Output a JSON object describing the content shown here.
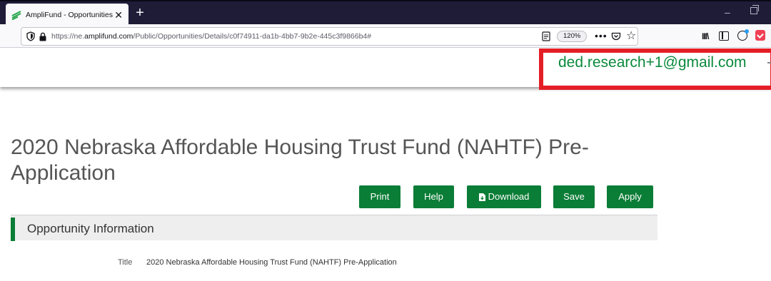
{
  "browser": {
    "tab_title": "AmpliFund - Opportunities",
    "tab_close": "✕",
    "new_tab": "+",
    "url_prefix": "https://ne.",
    "url_domain": "amplifund.com",
    "url_suffix": "/Public/Opportunities/Details/c0f74911-da1b-4bb7-9b2e-445c3f9866b4#",
    "zoom": "120%",
    "more_actions": "•••",
    "bookmark_star": "☆",
    "library": "III\\",
    "window_minimize": "–"
  },
  "header": {
    "user_email": "ded.research+1@gmail.com"
  },
  "main": {
    "page_title": "2020 Nebraska Affordable Housing Trust Fund (NAHTF) Pre-Application",
    "buttons": {
      "print": "Print",
      "help": "Help",
      "download": "Download",
      "save": "Save",
      "apply": "Apply"
    },
    "section": {
      "title": "Opportunity Information",
      "fields": [
        {
          "label": "Title",
          "value": "2020 Nebraska Affordable Housing Trust Fund (NAHTF) Pre-Application"
        }
      ]
    }
  },
  "colors": {
    "accent_green": "#0a7d36",
    "email_green": "#0a8a3c",
    "highlight_red": "#e41e26",
    "tabbar_dark": "#1f1c38"
  },
  "icons": [
    "amplifund-favicon-icon",
    "shield-icon",
    "lock-icon",
    "reader-view-icon",
    "pocket-icon",
    "star-icon",
    "library-icon",
    "sidebar-icon",
    "account-icon",
    "pocket-extension-icon",
    "download-file-icon"
  ]
}
